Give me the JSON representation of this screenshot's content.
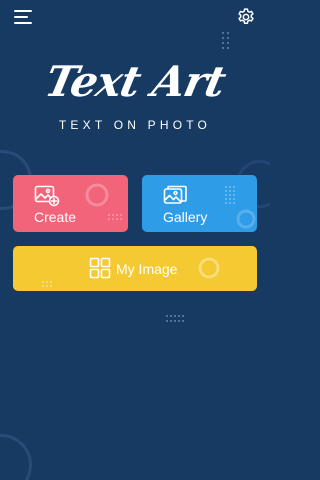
{
  "app": {
    "logo_text": "Text Art",
    "tagline": "TEXT ON PHOTO"
  },
  "toolbar": {
    "menu_icon": "hamburger-menu-icon",
    "settings_icon": "gear-icon"
  },
  "actions": {
    "create": {
      "label": "Create",
      "icon": "image-add-icon",
      "color": "#f2647a"
    },
    "gallery": {
      "label": "Gallery",
      "icon": "photo-gallery-icon",
      "color": "#2f9ce8"
    },
    "my_image": {
      "label": "My Image",
      "icon": "grid-icon",
      "color": "#f5c932"
    }
  },
  "theme": {
    "background": "#173a63",
    "text": "#ffffff"
  }
}
